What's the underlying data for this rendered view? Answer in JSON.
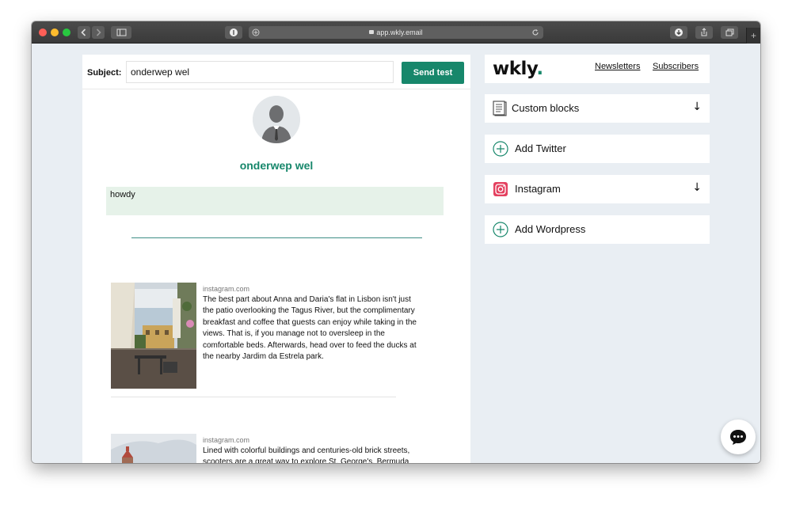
{
  "browser": {
    "url": "app.wkly.email",
    "new_tab": "+"
  },
  "editor": {
    "subject_label": "Subject:",
    "subject_value": "onderwep wel",
    "send_test_label": "Send test",
    "sender_name": "onderwep wel",
    "greeting_text": "howdy",
    "posts": [
      {
        "source": "instagram.com",
        "text": "The best part about Anna and Daria's flat in Lisbon isn't just the patio overlooking the Tagus River, but the complimentary breakfast and coffee that guests can enjoy while taking in the views. That is, if you manage not to oversleep in the comfortable beds. Afterwards, head over to feed the ducks at the nearby Jardim da Estrela park."
      },
      {
        "source": "instagram.com",
        "text": "Lined with colorful buildings and centuries-old brick streets, scooters are a great way to explore St. George's, Bermuda"
      }
    ]
  },
  "sidebar": {
    "logo_text": "wkly",
    "logo_dot": ".",
    "nav": {
      "newsletters": "Newsletters",
      "subscribers": "Subscribers"
    },
    "blocks": [
      {
        "label": "Custom blocks",
        "icon": "document-icon",
        "arrow": "↓"
      },
      {
        "label": "Add Twitter",
        "icon": "add-circle-icon"
      },
      {
        "label": "Instagram",
        "icon": "instagram-icon",
        "arrow": "↓"
      },
      {
        "label": "Add Wordpress",
        "icon": "add-circle-icon"
      }
    ]
  },
  "colors": {
    "accent": "#17876b",
    "instagram": "#e4405f",
    "greeting_bg": "#e6f2e9"
  }
}
